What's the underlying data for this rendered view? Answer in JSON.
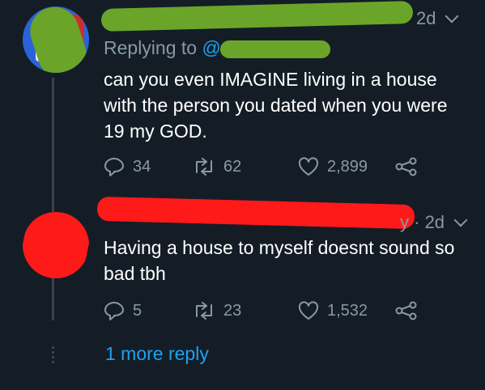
{
  "tweets": [
    {
      "time": "2d",
      "replying_label": "Replying to",
      "replying_handle": "@",
      "text": "can you even IMAGINE living in a house with the person you dated when you were 19 my GOD.",
      "replies": "34",
      "retweets": "62",
      "likes": "2,899"
    },
    {
      "time_prefix": "y · ",
      "time": "2d",
      "text": "Having a house to myself doesnt sound so bad tbh",
      "replies": "5",
      "retweets": "23",
      "likes": "1,532"
    }
  ],
  "more_replies": "1 more reply",
  "colors": {
    "background": "#141d26",
    "muted": "#8899a6",
    "accent": "#1da1f2",
    "redact_green": "#6aa52a",
    "redact_red": "#ff1a1a"
  },
  "icons": [
    "reply-icon",
    "retweet-icon",
    "like-icon",
    "share-icon",
    "chevron-down-icon"
  ]
}
